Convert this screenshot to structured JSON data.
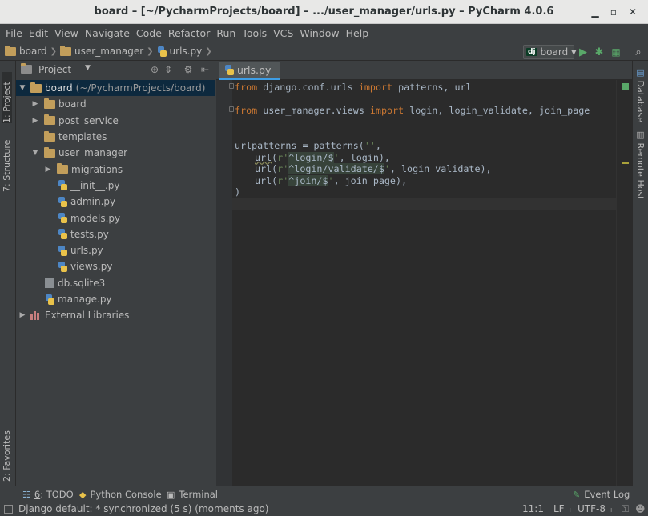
{
  "window": {
    "title": "board – [~/PycharmProjects/board] – .../user_manager/urls.py – PyCharm 4.0.6"
  },
  "menu": [
    {
      "mn": "F",
      "rest": "ile"
    },
    {
      "mn": "E",
      "rest": "dit"
    },
    {
      "mn": "V",
      "rest": "iew"
    },
    {
      "mn": "N",
      "rest": "avigate"
    },
    {
      "mn": "C",
      "rest": "ode"
    },
    {
      "mn": "R",
      "rest": "efactor"
    },
    {
      "mn": "R",
      "rest": "un"
    },
    {
      "mn": "T",
      "rest": "ools"
    },
    {
      "mn": "",
      "rest": "VCS"
    },
    {
      "mn": "W",
      "rest": "indow"
    },
    {
      "mn": "H",
      "rest": "elp"
    }
  ],
  "breadcrumb": [
    "board",
    "user_manager",
    "urls.py"
  ],
  "run_config": {
    "badge": "dj",
    "label": "board"
  },
  "left_tabs": [
    "1: Project",
    "7: Structure",
    "2: Favorites"
  ],
  "right_tabs": [
    "Database",
    "Remote Host"
  ],
  "project_panel": {
    "title": "Project"
  },
  "tree": [
    {
      "label": "board",
      "hint": "(~/PycharmProjects/board)",
      "icon": "folder-icon",
      "arrow": "▼"
    },
    {
      "label": "board",
      "hint": "",
      "icon": "folder-icon",
      "arrow": "▶"
    },
    {
      "label": "post_service",
      "hint": "",
      "icon": "folder-icon",
      "arrow": "▶"
    },
    {
      "label": "templates",
      "hint": "",
      "icon": "folder-icon",
      "arrow": ""
    },
    {
      "label": "user_manager",
      "hint": "",
      "icon": "folder-icon",
      "arrow": "▼"
    },
    {
      "label": "migrations",
      "hint": "",
      "icon": "folder-icon",
      "arrow": "▶"
    },
    {
      "label": "__init__.py",
      "hint": "",
      "icon": "python-file-icon",
      "arrow": ""
    },
    {
      "label": "admin.py",
      "hint": "",
      "icon": "python-file-icon",
      "arrow": ""
    },
    {
      "label": "models.py",
      "hint": "",
      "icon": "python-file-icon",
      "arrow": ""
    },
    {
      "label": "tests.py",
      "hint": "",
      "icon": "python-file-icon",
      "arrow": ""
    },
    {
      "label": "urls.py",
      "hint": "",
      "icon": "python-file-icon",
      "arrow": ""
    },
    {
      "label": "views.py",
      "hint": "",
      "icon": "python-file-icon",
      "arrow": ""
    },
    {
      "label": "db.sqlite3",
      "hint": "",
      "icon": "file-icon",
      "arrow": ""
    },
    {
      "label": "manage.py",
      "hint": "",
      "icon": "python-file-icon",
      "arrow": ""
    },
    {
      "label": "External Libraries",
      "hint": "",
      "icon": "library-icon",
      "arrow": "▶"
    }
  ],
  "editor": {
    "tab": "urls.py",
    "code": {
      "l1_kw1": "from",
      "l1_mod": " django.conf.urls ",
      "l1_kw2": "import",
      "l1_rest": " patterns, url",
      "l2_kw1": "from",
      "l2_mod": " user_manager.views ",
      "l2_kw2": "import",
      "l2_rest": " login, login_validate, join_page",
      "l3_a": "urlpatterns = patterns(",
      "l3_s": "''",
      "l3_b": ",",
      "l4_fn": "url",
      "l4_p": "(",
      "l4_r": "r'",
      "l4_rx": "^login/$",
      "l4_q": "'",
      "l4_rest": ", login),",
      "l5_fn": "url",
      "l5_p": "(",
      "l5_r": "r'",
      "l5_rx": "^login/validate/$",
      "l5_q": "'",
      "l5_rest": ", login_validate),",
      "l6_fn": "url",
      "l6_p": "(",
      "l6_r": "r'",
      "l6_rx": "^join/$",
      "l6_q": "'",
      "l6_rest": ", join_page),",
      "l7": ")"
    }
  },
  "bottom_tools": [
    {
      "icon": "todo-icon",
      "mn": "6",
      "label": ": TODO"
    },
    {
      "icon": "python-console-icon",
      "mn": "",
      "label": "Python Console"
    },
    {
      "icon": "terminal-icon",
      "mn": "",
      "label": "Terminal"
    },
    {
      "icon": "event-log-icon",
      "mn": "",
      "label": "Event Log"
    }
  ],
  "status": {
    "message": "Django default: * synchronized (5 s) (moments ago)",
    "position": "11:1",
    "line_sep": "LF",
    "encoding": "UTF-8"
  },
  "colors": {
    "accent": "#3e9ee6",
    "selection": "#0d293e",
    "editor_bg": "#2b2b2b"
  }
}
